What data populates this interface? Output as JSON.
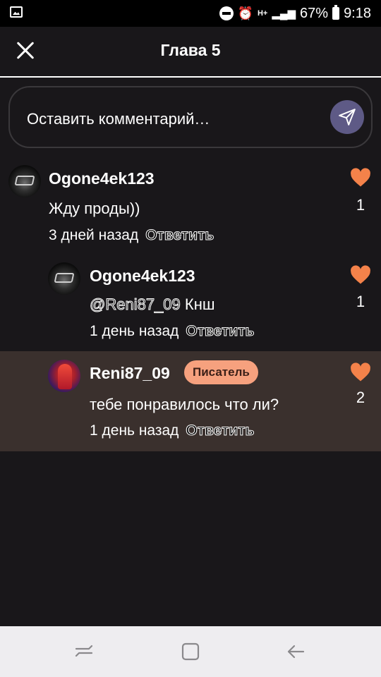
{
  "status_bar": {
    "battery": "67%",
    "time": "9:18",
    "network": "H+"
  },
  "header": {
    "title": "Глава 5"
  },
  "comment_input": {
    "placeholder": "Оставить комментарий…"
  },
  "comments": [
    {
      "username": "Ogone4ek123",
      "text": "Жду проды))",
      "time": "3 дней назад",
      "reply": "Ответить",
      "likes": "1"
    },
    {
      "username": "Ogone4ek123",
      "mention": "@Reni87_09",
      "text": "Кнш",
      "time": "1 день назад",
      "reply": "Ответить",
      "likes": "1"
    },
    {
      "username": "Reni87_09",
      "badge": "Писатель",
      "text": "тебе понравилось что ли?",
      "time": "1 день назад",
      "reply": "Ответить",
      "likes": "2"
    }
  ],
  "colors": {
    "background": "#19171a",
    "heart": "#f4824a",
    "highlight_row": "#3a302d",
    "badge": "#f6a17e",
    "send_button": "#5e5a86"
  }
}
